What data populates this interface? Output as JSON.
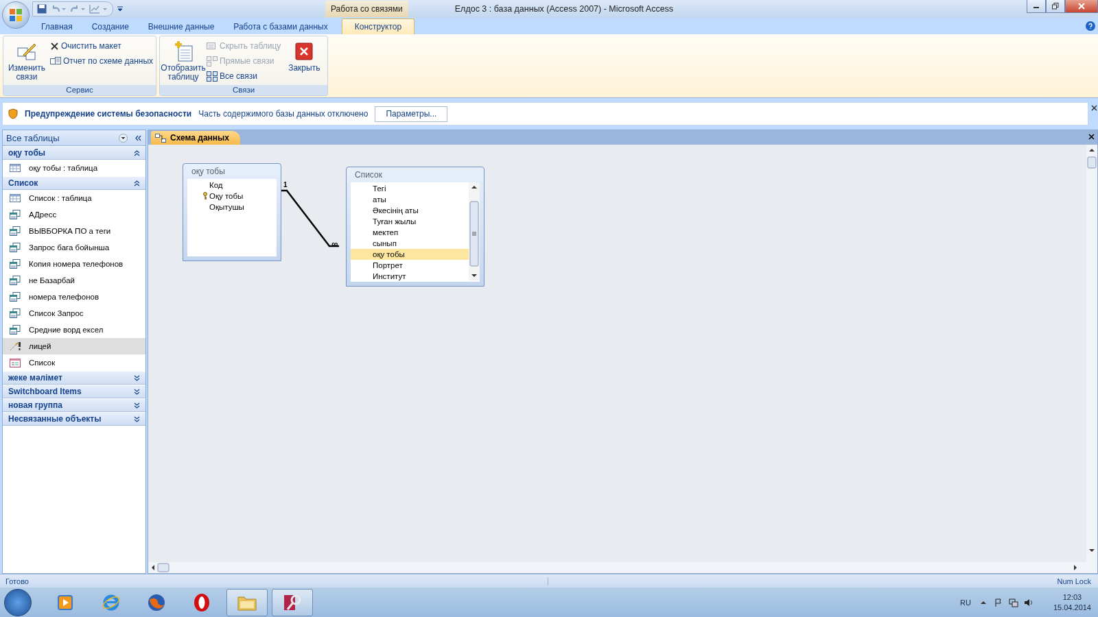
{
  "window": {
    "title": "Елдос 3 : база данных (Access 2007)  -  Microsoft Access",
    "contextual_tab": "Работа со связями"
  },
  "tabs": [
    {
      "label": "Главная",
      "selected": false
    },
    {
      "label": "Создание",
      "selected": false
    },
    {
      "label": "Внешние данные",
      "selected": false
    },
    {
      "label": "Работа с базами данных",
      "selected": false
    },
    {
      "label": "Конструктор",
      "selected": true
    }
  ],
  "ribbon": [
    {
      "title": "Сервис",
      "commands": [
        {
          "kind": "large",
          "label": "Изменить связи",
          "disabled": false
        },
        {
          "kind": "small",
          "label": "Очистить макет",
          "disabled": false
        },
        {
          "kind": "small",
          "label": "Отчет по схеме данных",
          "disabled": false
        }
      ]
    },
    {
      "title": "Связи",
      "commands": [
        {
          "kind": "large",
          "label": "Отобразить таблицу",
          "disabled": false
        },
        {
          "kind": "small",
          "label": "Скрыть таблицу",
          "disabled": true
        },
        {
          "kind": "small",
          "label": "Прямые связи",
          "disabled": true
        },
        {
          "kind": "small",
          "label": "Все связи",
          "disabled": false
        },
        {
          "kind": "large",
          "label": "Закрыть",
          "disabled": false
        }
      ]
    }
  ],
  "security_bar": {
    "title": "Предупреждение системы безопасности",
    "message": "Часть содержимого базы данных отключено",
    "button": "Параметры..."
  },
  "nav_pane": {
    "title": "Все таблицы",
    "groups": [
      {
        "title": "оқу тобы",
        "expanded": true,
        "items": [
          {
            "kind": "table",
            "label": "оқу тобы : таблица",
            "selected": false
          }
        ]
      },
      {
        "title": "Список",
        "expanded": true,
        "items": [
          {
            "kind": "table",
            "label": "Список : таблица",
            "selected": false
          },
          {
            "kind": "query",
            "label": "АДресс",
            "selected": false
          },
          {
            "kind": "query",
            "label": "ВЫВБОРКА  ПО а теги",
            "selected": false
          },
          {
            "kind": "query",
            "label": "Запрос бага бойынша",
            "selected": false
          },
          {
            "kind": "query",
            "label": "Копия номера телефонов",
            "selected": false
          },
          {
            "kind": "query",
            "label": "не Базарбай",
            "selected": false
          },
          {
            "kind": "query",
            "label": "номера телефонов",
            "selected": false
          },
          {
            "kind": "query",
            "label": "Список Запрос",
            "selected": false
          },
          {
            "kind": "query",
            "label": "Средние ворд ексел",
            "selected": false
          },
          {
            "kind": "macro",
            "label": "лицей",
            "selected": true
          },
          {
            "kind": "form",
            "label": "Список",
            "selected": false
          }
        ]
      },
      {
        "title": "жеке мәлімет",
        "expanded": false
      },
      {
        "title": "Switchboard Items",
        "expanded": false
      },
      {
        "title": "новая группа",
        "expanded": false
      },
      {
        "title": "Несвязанные объекты",
        "expanded": false
      }
    ]
  },
  "document_tab": {
    "label": "Схема данных"
  },
  "diagram": {
    "tables": [
      {
        "title": "оқу тобы",
        "fields": [
          {
            "name": "Код",
            "key": false,
            "selected": false
          },
          {
            "name": "Оқу тобы",
            "key": true,
            "selected": false
          },
          {
            "name": "Оқытушы",
            "key": false,
            "selected": false
          }
        ]
      },
      {
        "title": "Список",
        "fields": [
          {
            "name": "Тегі",
            "key": false,
            "selected": false
          },
          {
            "name": "аты",
            "key": false,
            "selected": false
          },
          {
            "name": "Әкесінің аты",
            "key": false,
            "selected": false
          },
          {
            "name": "Туған жылы",
            "key": false,
            "selected": false
          },
          {
            "name": "мектеп",
            "key": false,
            "selected": false
          },
          {
            "name": "сынып",
            "key": false,
            "selected": false
          },
          {
            "name": "оқу тобы",
            "key": false,
            "selected": true
          },
          {
            "name": "Портрет",
            "key": false,
            "selected": false
          },
          {
            "name": "Институт",
            "key": false,
            "selected": false
          }
        ]
      }
    ],
    "relationship": {
      "one_label": "1",
      "many_label": "∞"
    }
  },
  "status_bar": {
    "left": "Готово",
    "right": "Num Lock"
  },
  "taskbar": {
    "apps": [
      {
        "kind": "media",
        "running": false
      },
      {
        "kind": "ie",
        "running": false
      },
      {
        "kind": "firefox",
        "running": false
      },
      {
        "kind": "opera",
        "running": false
      },
      {
        "kind": "explorer",
        "running": true
      },
      {
        "kind": "access",
        "running": true
      }
    ],
    "language": "RU",
    "time": "12:03",
    "date": "15.04.2014"
  }
}
